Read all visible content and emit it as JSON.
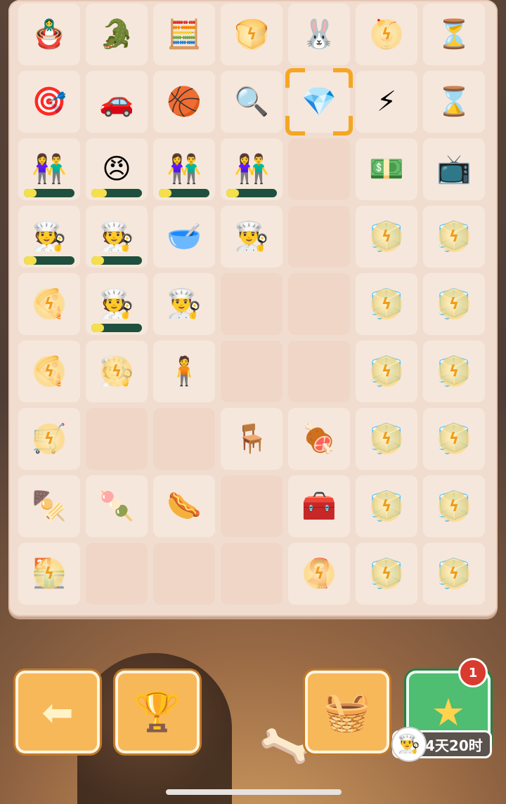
{
  "board": {
    "rows": [
      [
        {
          "icon": "matryoshka-doll-icon",
          "glyph": "🪆"
        },
        {
          "icon": "crocodile-toy-icon",
          "glyph": "🐊"
        },
        {
          "icon": "calculator-icon",
          "glyph": "🧮"
        },
        {
          "icon": "toaster-energy-icon",
          "glyph": "🍞",
          "bolt": true
        },
        {
          "icon": "bunny-megaphone-icon",
          "glyph": "🐰"
        },
        {
          "icon": "drink-energy-icon",
          "glyph": "🍹",
          "bolt": true
        },
        {
          "icon": "hourglass-blue-icon",
          "glyph": "⏳"
        }
      ],
      [
        {
          "icon": "ring-toss-icon",
          "glyph": "🎯"
        },
        {
          "icon": "toy-car-icon",
          "glyph": "🚗"
        },
        {
          "icon": "basketball-arcade-icon",
          "glyph": "🏀"
        },
        {
          "icon": "magnifying-glass-fish-icon",
          "glyph": "🔍"
        },
        {
          "icon": "purple-gem-icon",
          "glyph": "💎",
          "selected": true
        },
        {
          "icon": "energy-coin-icon",
          "glyph": "⚡"
        },
        {
          "icon": "hourglass-gold-icon",
          "glyph": "⌛"
        }
      ],
      [
        {
          "icon": "couple-customer-icon",
          "glyph": "👫",
          "progress": 0.25
        },
        {
          "icon": "grumpy-customer-icon",
          "glyph": "😠",
          "progress": 0.3
        },
        {
          "icon": "couple-customer-icon",
          "glyph": "👫",
          "progress": 0.25
        },
        {
          "icon": "couple-customer-icon",
          "glyph": "👫",
          "progress": 0.25
        },
        {
          "icon": "empty-cell",
          "glyph": ""
        },
        {
          "icon": "cash-pile-icon",
          "glyph": "💵"
        },
        {
          "icon": "television-icon",
          "glyph": "📺"
        }
      ],
      [
        {
          "icon": "chef-customer-icon",
          "glyph": "🧑‍🍳",
          "progress": 0.25
        },
        {
          "icon": "chef-customer-icon",
          "glyph": "🧑‍🍳",
          "progress": 0.25
        },
        {
          "icon": "bowl-icon",
          "glyph": "🥣"
        },
        {
          "icon": "chef-hat-icon",
          "glyph": "👨‍🍳"
        },
        {
          "icon": "empty-cell",
          "glyph": ""
        },
        {
          "icon": "cooler-energy-icon",
          "glyph": "🧊",
          "bolt": true
        },
        {
          "icon": "cooler-energy-icon",
          "glyph": "🧊",
          "bolt": true
        }
      ],
      [
        {
          "icon": "pizza-chef-energy-icon",
          "glyph": "🍕",
          "bolt": true
        },
        {
          "icon": "chef-customer-icon",
          "glyph": "🧑‍🍳",
          "progress": 0.25
        },
        {
          "icon": "chef-hat-icon",
          "glyph": "👨‍🍳"
        },
        {
          "icon": "empty-cell",
          "glyph": ""
        },
        {
          "icon": "empty-cell",
          "glyph": ""
        },
        {
          "icon": "cooler-energy-icon",
          "glyph": "🧊",
          "bolt": true
        },
        {
          "icon": "cooler-energy-icon",
          "glyph": "🧊",
          "bolt": true
        }
      ],
      [
        {
          "icon": "pizza-chef-energy-icon",
          "glyph": "🍕",
          "bolt": true
        },
        {
          "icon": "chef-energy-icon",
          "glyph": "🧑‍🍳",
          "bolt": true
        },
        {
          "icon": "apprentice-chef-icon",
          "glyph": "🧍"
        },
        {
          "icon": "empty-cell",
          "glyph": ""
        },
        {
          "icon": "empty-cell",
          "glyph": ""
        },
        {
          "icon": "cooler-energy-icon",
          "glyph": "🧊",
          "bolt": true
        },
        {
          "icon": "cooler-energy-icon",
          "glyph": "🧊",
          "bolt": true
        }
      ],
      [
        {
          "icon": "food-cart-energy-icon",
          "glyph": "🛒",
          "bolt": true
        },
        {
          "icon": "empty-cell",
          "glyph": ""
        },
        {
          "icon": "empty-cell",
          "glyph": ""
        },
        {
          "icon": "grill-bench-icon",
          "glyph": "🪑"
        },
        {
          "icon": "grill-cart-icon",
          "glyph": "🍖"
        },
        {
          "icon": "cooler-energy-icon",
          "glyph": "🧊",
          "bolt": true
        },
        {
          "icon": "cooler-energy-icon",
          "glyph": "🧊",
          "bolt": true
        }
      ],
      [
        {
          "icon": "green-skewer-icon",
          "glyph": "🍢"
        },
        {
          "icon": "meat-skewers-icon",
          "glyph": "🍡"
        },
        {
          "icon": "sausage-skewer-icon",
          "glyph": "🌭"
        },
        {
          "icon": "empty-cell",
          "glyph": ""
        },
        {
          "icon": "blue-toolbox-icon",
          "glyph": "🧰"
        },
        {
          "icon": "cooler-energy-icon",
          "glyph": "🧊",
          "bolt": true
        },
        {
          "icon": "cooler-energy-icon",
          "glyph": "🧊",
          "bolt": true
        }
      ],
      [
        {
          "icon": "stall-energy-icon",
          "glyph": "🏪",
          "bolt": true
        },
        {
          "icon": "empty-cell",
          "glyph": ""
        },
        {
          "icon": "empty-cell",
          "glyph": ""
        },
        {
          "icon": "empty-cell",
          "glyph": ""
        },
        {
          "icon": "cloth-energy-icon",
          "glyph": "🧣",
          "bolt": true
        },
        {
          "icon": "cooler-energy-icon",
          "glyph": "🧊",
          "bolt": true
        },
        {
          "icon": "cooler-energy-icon",
          "glyph": "🧊",
          "bolt": true
        }
      ]
    ]
  },
  "hud": {
    "back_icon": "arrow-left-icon",
    "leaderboard_icon": "podium-icon",
    "basket_icon": "basket-icon",
    "event_icon": "star-icon",
    "event_badge": "1",
    "timer": "4天20时"
  },
  "colors": {
    "board": "#f1ddd0",
    "cell": "#f6e7dc",
    "button": "#f7b85a",
    "event_button": "#4fbd72",
    "badge": "#d93b2e",
    "progress_bg": "#1f4f3e",
    "progress_fill": "#f5df4c",
    "selector": "#f5a623"
  }
}
